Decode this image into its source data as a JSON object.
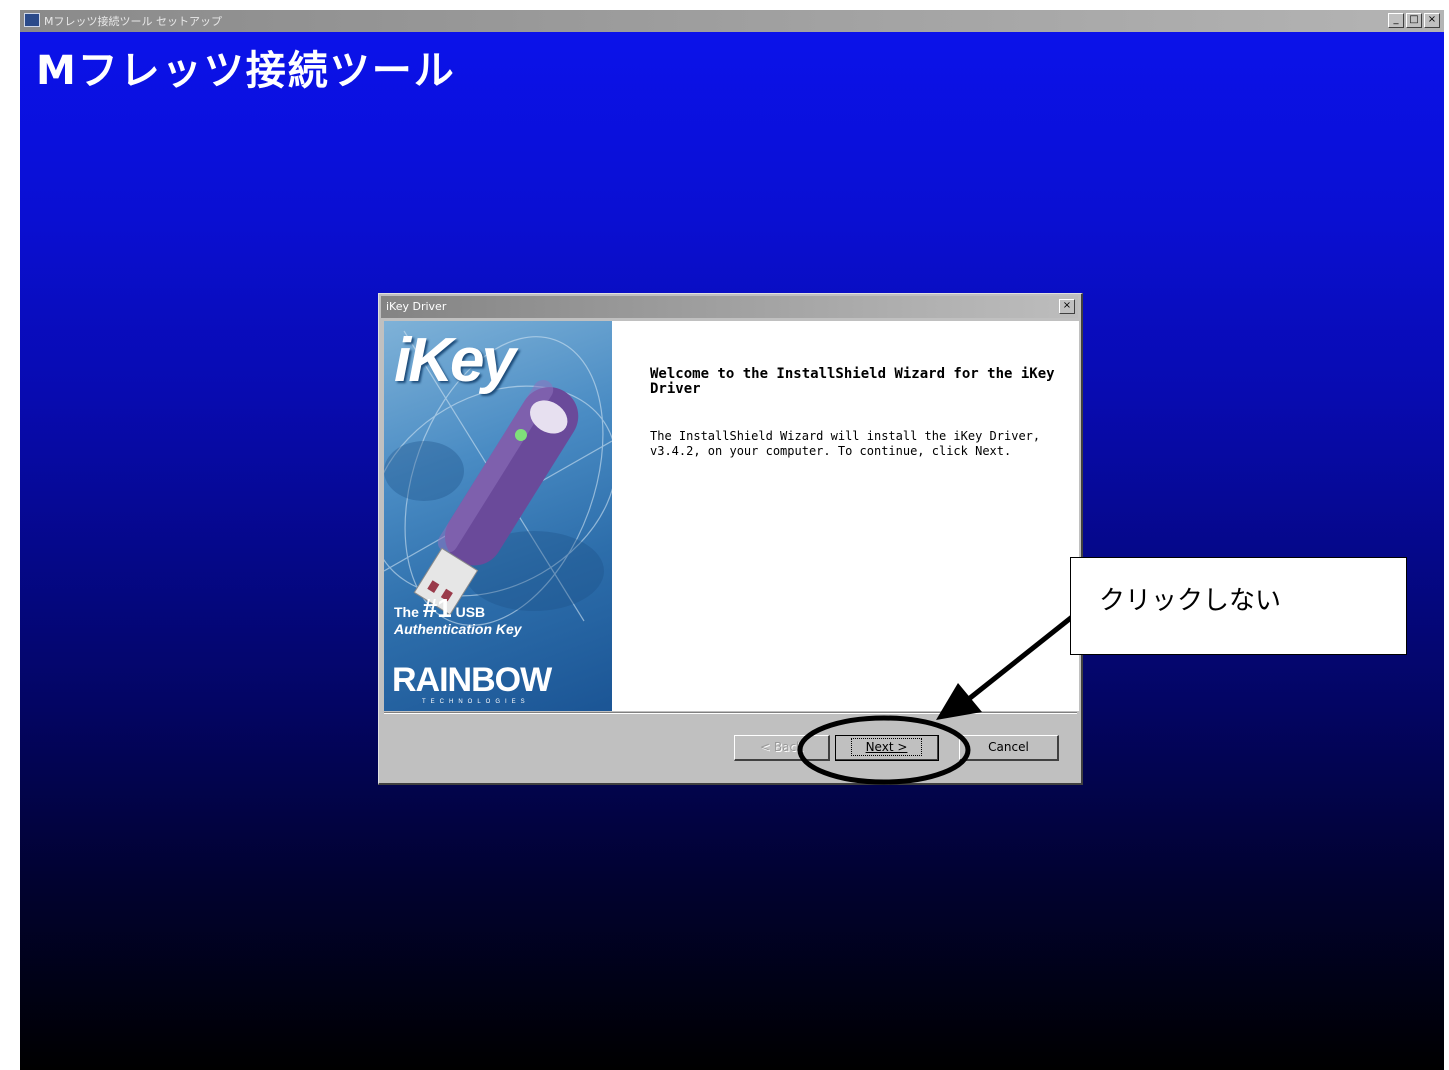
{
  "outer_window": {
    "title": "Mフレッツ接続ツール セットアップ",
    "heading": "Mフレッツ接続ツール",
    "minimize_glyph": "_",
    "maximize_glyph": "□",
    "close_glyph": "×",
    "system_icon": "setup-app-icon"
  },
  "dialog": {
    "title": "iKey Driver",
    "close_glyph": "×",
    "side_panel": {
      "logo": "iKey",
      "tagline_prefix": "The",
      "tagline_number": "#1",
      "tagline_suffix": "USB",
      "tagline_line2": "Authentication Key",
      "brand": "RAINBOW",
      "brand_sub": "TECHNOLOGIES"
    },
    "welcome_heading": "Welcome to the InstallShield Wizard for the iKey Driver",
    "welcome_body_line1": "The InstallShield Wizard will install the iKey Driver,",
    "welcome_body_line2": "v3.4.2, on your computer. To continue, click Next.",
    "buttons": {
      "back": "< Back",
      "next": "Next >",
      "cancel": "Cancel"
    }
  },
  "annotation": {
    "callout_text": "クリックしない"
  },
  "colors": {
    "desktop_top": "#0b12ea",
    "desktop_bottom": "#000000",
    "dialog_face": "#c0c0c0",
    "side_panel_blue": "#2d6eab",
    "usb_key_purple": "#6a4a9a"
  }
}
